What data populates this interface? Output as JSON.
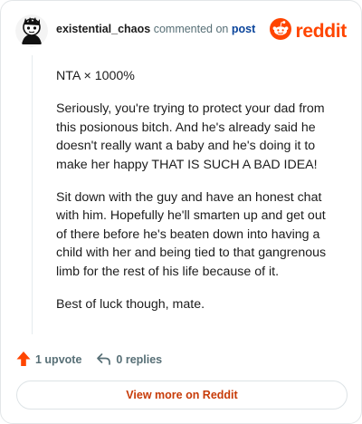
{
  "header": {
    "username": "existential_chaos",
    "verb": "commented on",
    "post_link": "post"
  },
  "brand": {
    "wordmark": "reddit",
    "icon": "reddit-snoo-icon",
    "color": "#ff4500"
  },
  "comment": {
    "paragraphs": [
      "NTA × 1000%",
      "Seriously, you're trying to protect your dad from this posionous bitch. And he's already said he doesn't really want a baby and he's doing it to make her happy THAT IS SUCH A BAD IDEA!",
      "Sit down with the guy and have an honest chat with him. Hopefully he'll smarten up and get out of there before he's beaten down into having a child with her and being tied to that gangrenous limb for the rest of his life because of it.",
      "Best of luck though, mate."
    ]
  },
  "actions": {
    "upvote_label": "1 upvote",
    "upvote_icon": "upvote-arrow-icon",
    "upvote_color": "#ff4500",
    "replies_label": "0 replies",
    "replies_icon": "reply-arrow-icon"
  },
  "footer": {
    "more_label": "View more on Reddit"
  }
}
